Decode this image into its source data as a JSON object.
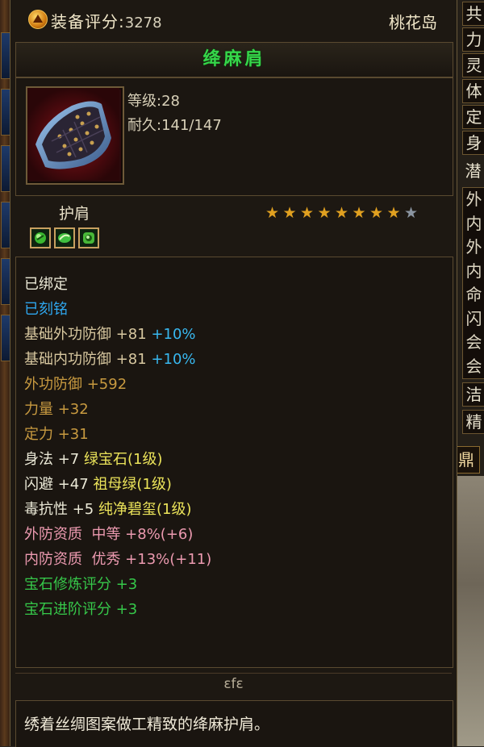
{
  "header": {
    "score_label": "装备评分:",
    "score_value": "3278",
    "location": "桃花岛"
  },
  "item": {
    "name": "绛麻肩",
    "level": "等级:28",
    "durability": "耐久:141/147",
    "type": "护肩",
    "stars": {
      "filled": 8,
      "total": 9
    },
    "gem_slots": [
      "green-gem",
      "green-gem",
      "green-gem"
    ]
  },
  "attributes": [
    {
      "segments": [
        {
          "text": "已绑定",
          "color": "#ecead8"
        }
      ]
    },
    {
      "segments": [
        {
          "text": "已刻铭",
          "color": "#2ea6ee"
        }
      ]
    },
    {
      "segments": [
        {
          "text": "基础外功防御 +81 ",
          "color": "#d8c8a0"
        },
        {
          "text": "+10%",
          "color": "#38b8f0"
        }
      ]
    },
    {
      "segments": [
        {
          "text": "基础内功防御 +81 ",
          "color": "#d8c8a0"
        },
        {
          "text": "+10%",
          "color": "#38b8f0"
        }
      ]
    },
    {
      "segments": [
        {
          "text": "外功防御 +592",
          "color": "#c89a40"
        }
      ]
    },
    {
      "segments": [
        {
          "text": "力量 +32",
          "color": "#c89a40"
        }
      ]
    },
    {
      "segments": [
        {
          "text": "定力 +31",
          "color": "#c89a40"
        }
      ]
    },
    {
      "segments": [
        {
          "text": "身法 +7 ",
          "color": "#ecead8"
        },
        {
          "text": "绿宝石(1级)",
          "color": "#ece45a"
        }
      ]
    },
    {
      "segments": [
        {
          "text": "闪避 +47 ",
          "color": "#ecead8"
        },
        {
          "text": "祖母绿(1级)",
          "color": "#ece45a"
        }
      ]
    },
    {
      "segments": [
        {
          "text": "毒抗性 +5 ",
          "color": "#ecead8"
        },
        {
          "text": "纯净碧玺(1级)",
          "color": "#ece45a"
        }
      ]
    },
    {
      "segments": [
        {
          "text": "外防资质  中等 +8%(+6)",
          "color": "#ec9ab0"
        }
      ]
    },
    {
      "segments": [
        {
          "text": "内防资质  优秀 +13%(+11)",
          "color": "#ec9ab0"
        }
      ]
    },
    {
      "segments": [
        {
          "text": "宝石修炼评分 +3",
          "color": "#36c84a"
        }
      ]
    },
    {
      "segments": [
        {
          "text": "宝石进阶评分 +3",
          "color": "#36c84a"
        }
      ]
    }
  ],
  "maker": "ɛfɛ",
  "description": "绣着丝绸图案做工精致的绛麻护肩。",
  "side_panel": {
    "tabs": [
      "共",
      "力",
      "灵",
      "体",
      "定",
      "身"
    ],
    "section_label": "潜",
    "list": [
      "外",
      "内",
      "外",
      "内",
      "命",
      "闪",
      "会",
      "会"
    ],
    "more_tabs": [
      "洁",
      "精"
    ],
    "gem_button": "鼎"
  },
  "colors": {
    "item_name": "#35d64a",
    "star_filled": "#e0a020",
    "star_empty": "#8a94a0"
  }
}
